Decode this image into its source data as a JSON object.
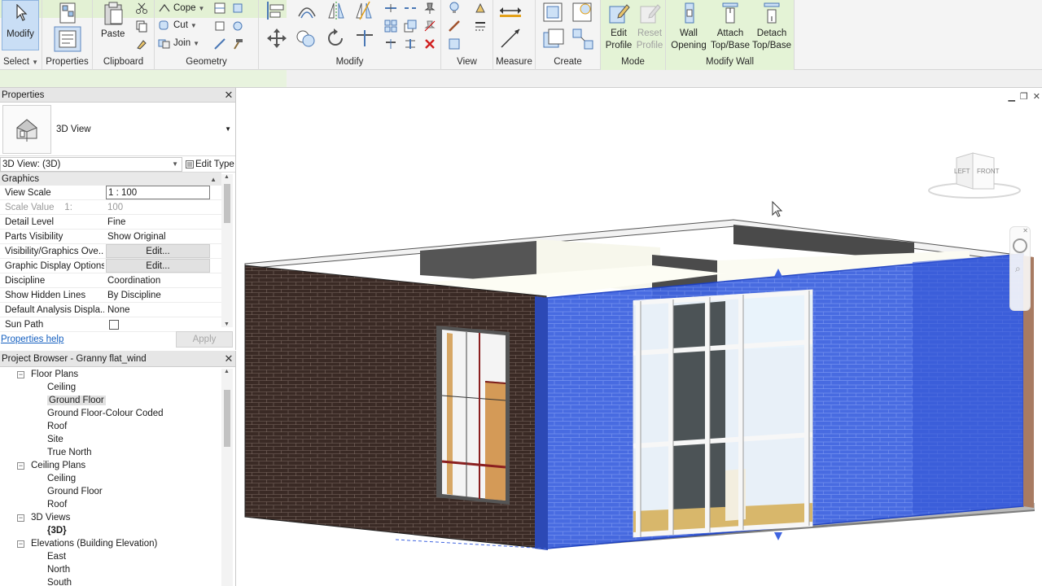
{
  "ribbon": {
    "select": {
      "big": "Modify",
      "label": "Select"
    },
    "properties": {
      "label": "Properties"
    },
    "clipboard": {
      "paste": "Paste",
      "label": "Clipboard"
    },
    "geometry": {
      "cope": "Cope",
      "cut": "Cut",
      "join": "Join",
      "label": "Geometry"
    },
    "modify": {
      "label": "Modify"
    },
    "view": {
      "label": "View"
    },
    "measure": {
      "label": "Measure"
    },
    "create": {
      "label": "Create"
    },
    "mode": {
      "edit_profile": [
        "Edit",
        "Profile"
      ],
      "reset_profile": [
        "Reset",
        "Profile"
      ],
      "label": "Mode"
    },
    "modify_wall": {
      "wall_opening": [
        "Wall",
        "Opening"
      ],
      "attach": [
        "Attach",
        "Top/Base"
      ],
      "detach": [
        "Detach",
        "Top/Base"
      ],
      "label": "Modify Wall"
    }
  },
  "properties_panel": {
    "title": "Properties",
    "type_name": "3D View",
    "instance_selector": "3D View: (3D)",
    "edit_type": "Edit Type",
    "section": "Graphics",
    "rows": [
      {
        "key": "View Scale",
        "value": "1 : 100"
      },
      {
        "key": "Scale Value    1:",
        "value": "100"
      },
      {
        "key": "Detail Level",
        "value": "Fine"
      },
      {
        "key": "Parts Visibility",
        "value": "Show Original"
      },
      {
        "key": "Visibility/Graphics Ove...",
        "value": "Edit..."
      },
      {
        "key": "Graphic Display Options",
        "value": "Edit..."
      },
      {
        "key": "Discipline",
        "value": "Coordination"
      },
      {
        "key": "Show Hidden Lines",
        "value": "By Discipline"
      },
      {
        "key": "Default Analysis Displa...",
        "value": "None"
      },
      {
        "key": "Sun Path",
        "value": ""
      }
    ],
    "help": "Properties help",
    "apply": "Apply"
  },
  "project_browser": {
    "title": "Project Browser - Granny flat_wind",
    "items": [
      {
        "label": "Floor Plans",
        "level": 1,
        "toggle": "−"
      },
      {
        "label": "Ceiling",
        "level": 2
      },
      {
        "label": "Ground Floor",
        "level": 2,
        "selected": true
      },
      {
        "label": "Ground Floor-Colour Coded",
        "level": 2
      },
      {
        "label": "Roof",
        "level": 2
      },
      {
        "label": "Site",
        "level": 2
      },
      {
        "label": "True North",
        "level": 2
      },
      {
        "label": "Ceiling Plans",
        "level": 1,
        "toggle": "−"
      },
      {
        "label": "Ceiling",
        "level": 2
      },
      {
        "label": "Ground Floor",
        "level": 2
      },
      {
        "label": "Roof",
        "level": 2
      },
      {
        "label": "3D Views",
        "level": 1,
        "toggle": "−"
      },
      {
        "label": "{3D}",
        "level": 2,
        "bold": true
      },
      {
        "label": "Elevations (Building Elevation)",
        "level": 1,
        "toggle": "−"
      },
      {
        "label": "East",
        "level": 2
      },
      {
        "label": "North",
        "level": 2
      },
      {
        "label": "South",
        "level": 2
      }
    ]
  },
  "viewcube": {
    "left": "LEFT",
    "front": "FRONT"
  },
  "colors": {
    "selection_blue": "#3d63e0",
    "brick_dark": "#3b2a25",
    "ribbon_context": "#e4f3d6"
  }
}
